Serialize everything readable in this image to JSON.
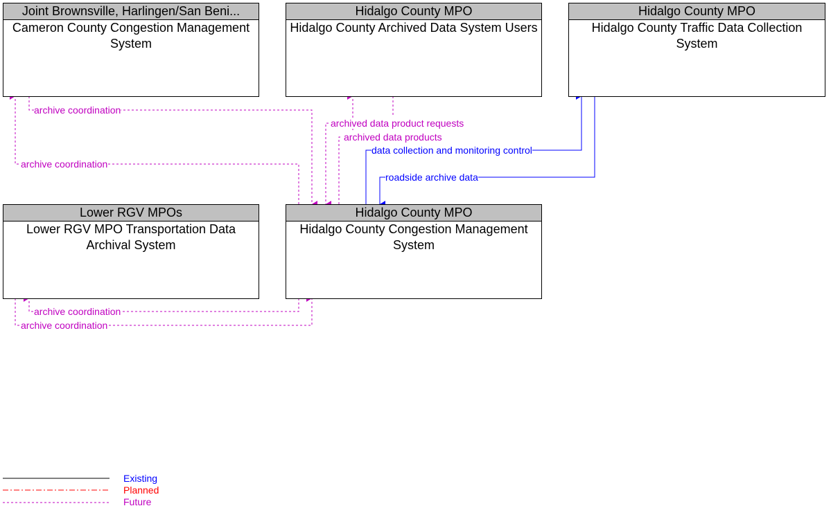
{
  "colors": {
    "future": "#c000c0",
    "existing": "#0000ff",
    "planned": "#ff0000",
    "box_header": "#c0c0c0"
  },
  "boxes": [
    {
      "header": "Joint Brownsville, Harlingen/San Beni...",
      "title": "Cameron County Congestion Management System"
    },
    {
      "header": "Hidalgo County MPO",
      "title": "Hidalgo County Archived Data System Users"
    },
    {
      "header": "Hidalgo County MPO",
      "title": "Hidalgo County Traffic Data Collection System"
    },
    {
      "header": "Lower RGV MPOs",
      "title": "Lower RGV MPO Transportation Data Archival System"
    },
    {
      "header": "Hidalgo County MPO",
      "title": "Hidalgo County Congestion Management System"
    }
  ],
  "flows": [
    {
      "label": "archive coordination",
      "status": "future"
    },
    {
      "label": "archive coordination",
      "status": "future"
    },
    {
      "label": "archived data product requests",
      "status": "future"
    },
    {
      "label": "archived data products",
      "status": "future"
    },
    {
      "label": "data collection and monitoring control",
      "status": "existing"
    },
    {
      "label": "roadside archive data",
      "status": "existing"
    },
    {
      "label": "archive coordination",
      "status": "future"
    },
    {
      "label": "archive coordination",
      "status": "future"
    }
  ],
  "legend": {
    "existing": "Existing",
    "planned": "Planned",
    "future": "Future"
  }
}
